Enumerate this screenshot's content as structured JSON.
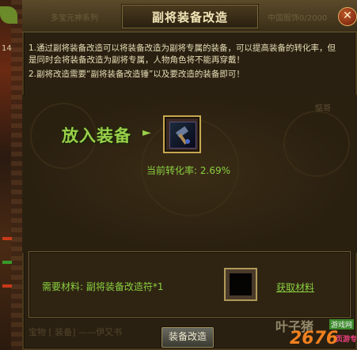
{
  "window": {
    "title": "副将装备改造",
    "close_label": "✕"
  },
  "background_game": {
    "left_number": "14",
    "bg_title_ghost_left": "多宝元神系列",
    "bg_title_ghost_right": "中国服饰0/2000",
    "bg_right_ghost": "惦哥",
    "bottom_ghost": "宝物 [ 装备] ——伊又书"
  },
  "instructions": [
    "1.通过副将装备改造可以将装备改造为副将专属的装备，可以提高装备的转化率，但是同时会将装备改造为副将专属，人物角色将不能再穿戴！",
    "2.副将改造需要“副将装备改造锤”以及要改造的装备即可！"
  ],
  "equip_section": {
    "put_label": "放入装备",
    "arrow": "►",
    "rate_label": "当前转化率:",
    "rate_value": "2.69%"
  },
  "material_section": {
    "label": "需要材料:",
    "item": "副将装备改造符*1",
    "obtain_link": "获取材料"
  },
  "buttons": {
    "modify": "装备改造"
  },
  "watermark": {
    "line1": "叶子猪",
    "line2": "2676",
    "line3": "游戏网",
    "line4": "页游专区"
  },
  "colors": {
    "accent_green": "#8ad040",
    "title_gold": "#f2e6b8",
    "frame_gold": "#c8a850"
  },
  "icons": {
    "close": "close-icon",
    "equip": "hammer-icon",
    "arrow": "arrow-right-icon"
  }
}
